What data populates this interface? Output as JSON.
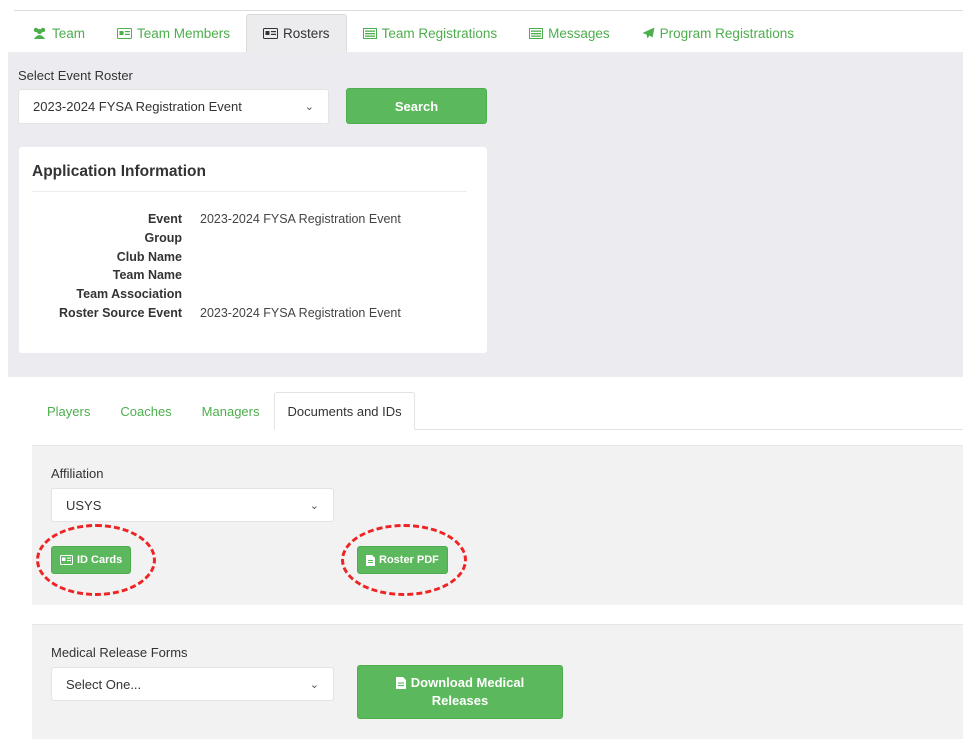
{
  "nav": {
    "tabs": [
      {
        "label": "Team",
        "icon": "users-icon"
      },
      {
        "label": "Team Members",
        "icon": "id-card-icon"
      },
      {
        "label": "Rosters",
        "icon": "id-card-icon"
      },
      {
        "label": "Team Registrations",
        "icon": "list-icon"
      },
      {
        "label": "Messages",
        "icon": "list-icon"
      },
      {
        "label": "Program Registrations",
        "icon": "paper-plane-icon"
      }
    ],
    "active": "Rosters"
  },
  "roster_select": {
    "label": "Select Event Roster",
    "value": "2023-2024 FYSA Registration Event",
    "search_label": "Search"
  },
  "application_info": {
    "title": "Application Information",
    "rows": [
      {
        "label": "Event",
        "value": "2023-2024 FYSA Registration Event"
      },
      {
        "label": "Group",
        "value": ""
      },
      {
        "label": "Club Name",
        "value": ""
      },
      {
        "label": "Team Name",
        "value": ""
      },
      {
        "label": "Team Association",
        "value": ""
      },
      {
        "label": "Roster Source Event",
        "value": "2023-2024 FYSA Registration Event"
      }
    ]
  },
  "sub_tabs": {
    "items": [
      "Players",
      "Coaches",
      "Managers",
      "Documents and IDs"
    ],
    "active": "Documents and IDs"
  },
  "affiliation": {
    "label": "Affiliation",
    "value": "USYS",
    "id_cards_label": "ID Cards",
    "roster_pdf_label": "Roster PDF"
  },
  "medical": {
    "label": "Medical Release Forms",
    "value": "Select One...",
    "download_label_1": "Download Medical",
    "download_label_2": "Releases"
  },
  "colors": {
    "accent": "#5cb85c",
    "link": "#4cae4c",
    "highlight": "#ee2323",
    "background_gray": "#ececf0"
  }
}
